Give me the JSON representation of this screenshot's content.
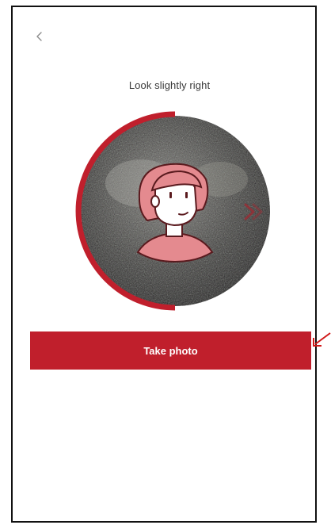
{
  "header": {
    "back_icon": "chevron-left-icon"
  },
  "main": {
    "instruction": "Look slightly right",
    "camera": {
      "progress_ring_color": "#c01f2c",
      "direction_hint_icon": "chevron-right-icon",
      "avatar_icon": "face-outline-icon"
    },
    "take_photo_label": "Take photo"
  },
  "colors": {
    "accent": "#c01f2c",
    "text": "#3a3a3a",
    "background": "#ffffff"
  }
}
